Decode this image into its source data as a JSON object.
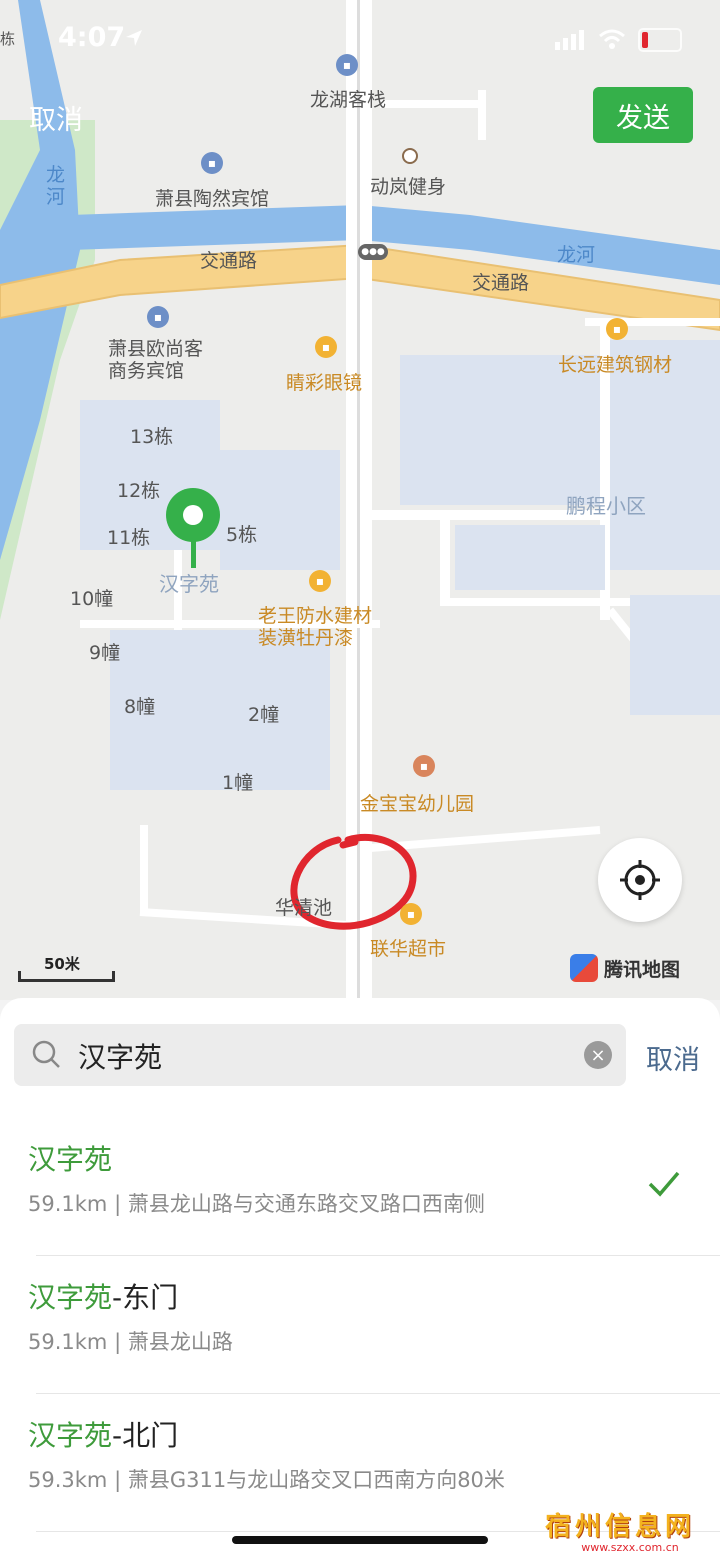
{
  "status_bar": {
    "time": "4:07"
  },
  "header": {
    "cancel_label": "取消",
    "send_label": "发送"
  },
  "map": {
    "labels": {
      "longhu": "龙湖客栈",
      "donglan": "动岚健身",
      "taoran": "萧县陶然宾馆",
      "jiaotong1": "交通路",
      "jiaotong2": "交通路",
      "longhe_v": "龙\n河",
      "longhe_h": "龙河",
      "oushang": "萧县欧尚客\n商务宾馆",
      "qingcai": "睛彩眼镜",
      "changyuan": "长远建筑钢材",
      "pengcheng": "鹏程小区",
      "b13": "13栋",
      "b12": "12栋",
      "b11": "11栋",
      "b5": "5栋",
      "hanziyuan": "汉字苑",
      "b10": "10幢",
      "b9": "9幢",
      "b8": "8幢",
      "b2": "2幢",
      "b1": "1幢",
      "laowang": "老王防水建材\n装潢牡丹漆",
      "jinbaobao": "金宝宝幼儿园",
      "huaqingchi": "华清池",
      "lianhua": "联华超市",
      "scale": "50米",
      "provider": "腾讯地图",
      "edge_dong": "栋"
    }
  },
  "search": {
    "query": "汉字苑",
    "cancel_label": "取消"
  },
  "results": [
    {
      "highlight": "汉字苑",
      "rest": "",
      "distance": "59.1km",
      "sep": "|",
      "address": "萧县龙山路与交通东路交叉路口西南侧",
      "selected": true
    },
    {
      "highlight": "汉字苑",
      "rest": "-东门",
      "distance": "59.1km",
      "sep": "|",
      "address": "萧县龙山路",
      "selected": false
    },
    {
      "highlight": "汉字苑",
      "rest": "-北门",
      "distance": "59.3km",
      "sep": "|",
      "address": "萧县G311与龙山路交叉口西南方向80米",
      "selected": false
    }
  ],
  "watermark": {
    "brand": "宿州信息网",
    "url": "www.szxx.com.cn"
  },
  "colors": {
    "accent": "#3e9b3b",
    "send_button": "#35b04a",
    "annotation": "#e0262e"
  }
}
